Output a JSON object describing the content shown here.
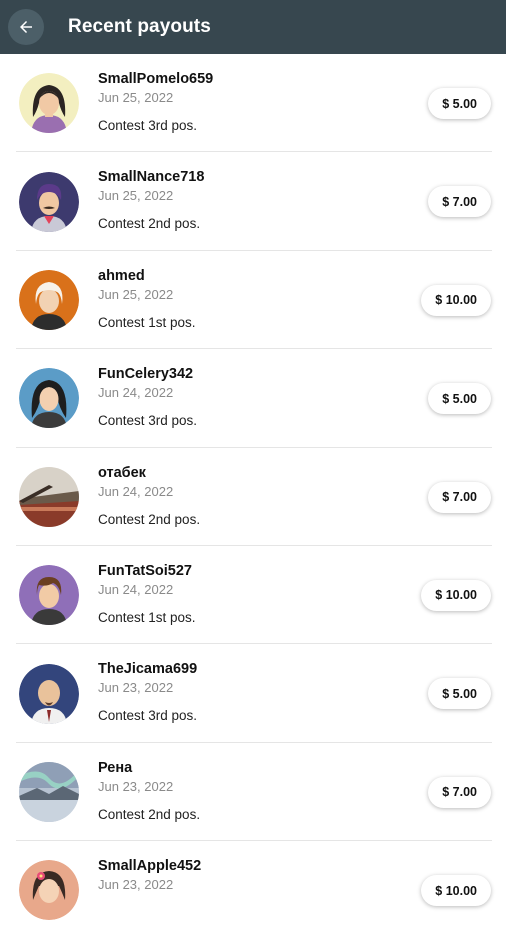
{
  "appbar": {
    "title": "Recent payouts",
    "back_icon": "arrow-left-icon"
  },
  "payouts": [
    {
      "name": "SmallPomelo659",
      "date": "Jun 25, 2022",
      "desc": "Contest 3rd pos.",
      "amount": "$ 5.00",
      "avatar": "avatar-girl-dark-hair",
      "avatar_bg": "#f3efc0"
    },
    {
      "name": "SmallNance718",
      "date": "Jun 25, 2022",
      "desc": "Contest 2nd pos.",
      "amount": "$ 7.00",
      "avatar": "avatar-boy-mustache",
      "avatar_bg": "#3d3a6e"
    },
    {
      "name": "ahmed",
      "date": "Jun 25, 2022",
      "desc": "Contest 1st pos.",
      "amount": "$ 10.00",
      "avatar": "avatar-old-man-white-hair",
      "avatar_bg": "#d9711a"
    },
    {
      "name": "FunCelery342",
      "date": "Jun 24, 2022",
      "desc": "Contest 3rd pos.",
      "amount": "$ 5.00",
      "avatar": "avatar-girl-black-hair",
      "avatar_bg": "#5b9cc7"
    },
    {
      "name": "отабек",
      "date": "Jun 24, 2022",
      "desc": "Contest 2nd pos.",
      "amount": "$ 7.00",
      "avatar": "avatar-photo-landscape",
      "avatar_bg": "#b8a48a"
    },
    {
      "name": "FunTatSoi527",
      "date": "Jun 24, 2022",
      "desc": "Contest 1st pos.",
      "amount": "$ 10.00",
      "avatar": "avatar-boy-brown-hair",
      "avatar_bg": "#8f6fb8"
    },
    {
      "name": "TheJicama699",
      "date": "Jun 23, 2022",
      "desc": "Contest 3rd pos.",
      "amount": "$ 5.00",
      "avatar": "avatar-bald-man-goatee",
      "avatar_bg": "#33457c"
    },
    {
      "name": "Рена",
      "date": "Jun 23, 2022",
      "desc": "Contest 2nd pos.",
      "amount": "$ 7.00",
      "avatar": "avatar-photo-aurora",
      "avatar_bg": "#9fb3c7"
    },
    {
      "name": "SmallApple452",
      "date": "Jun 23, 2022",
      "desc": "",
      "amount": "$ 10.00",
      "avatar": "avatar-girl-flower",
      "avatar_bg": "#e8a88b"
    }
  ]
}
